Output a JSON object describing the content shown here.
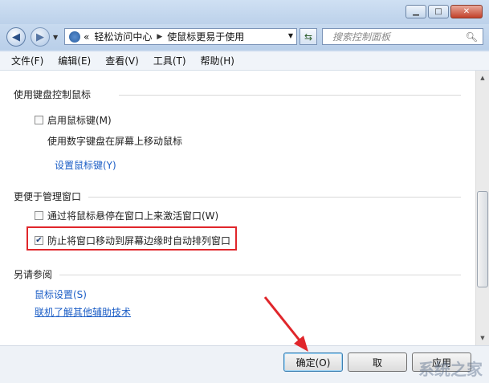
{
  "nav": {
    "breadcrumb": [
      "轻松访问中心",
      "使鼠标更易于使用"
    ],
    "overflow": "«",
    "search_placeholder": "搜索控制面板"
  },
  "menu": [
    "文件(F)",
    "编辑(E)",
    "查看(V)",
    "工具(T)",
    "帮助(H)"
  ],
  "sections": {
    "keyboard": {
      "title": "使用键盘控制鼠标",
      "checkbox_label": "启用鼠标键(M)",
      "checkbox_checked": false,
      "description": "使用数字键盘在屏幕上移动鼠标",
      "link": "设置鼠标键(Y)"
    },
    "windows": {
      "title": "更便于管理窗口",
      "hover_label": "通过将鼠标悬停在窗口上来激活窗口(W)",
      "hover_checked": false,
      "snap_label": "防止将窗口移动到屏幕边缘时自动排列窗口",
      "snap_checked": true
    },
    "see_also": {
      "title": "另请参阅",
      "links": [
        "鼠标设置(S)",
        "联机了解其他辅助技术"
      ]
    }
  },
  "buttons": {
    "ok": "确定(O)",
    "partial_2": "取",
    "partial_3": "应用"
  },
  "watermark": "系统之家",
  "icons": {
    "back": "back-arrow-icon",
    "forward": "forward-arrow-icon",
    "refresh": "refresh-icon",
    "search": "search-icon",
    "control_panel": "control-panel-icon"
  },
  "colors": {
    "link": "#1c5ec6",
    "highlight": "#e0262b",
    "close_button": "#c2412a"
  }
}
